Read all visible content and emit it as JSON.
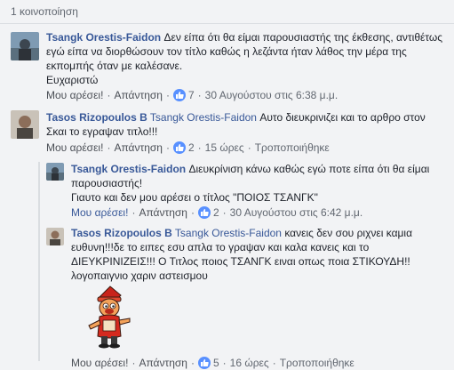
{
  "share_count": "1 κοινοποίηση",
  "comments": [
    {
      "author": "Tsangk Orestis-Faidon",
      "text": "Δεν είπα ότι θα είμαι παρουσιαστής της έκθεσης, αντιθέτως εγώ είπα να διορθώσουν τον τίτλο καθώς η λεζάντα ήταν λάθος την μέρα της εκπομπής όταν με καλέσανε.",
      "text2": "Ευχαριστώ",
      "like": "Μου αρέσει!",
      "reply": "Απάντηση",
      "reactions": "7",
      "time": "30 Αυγούστου στις 6:38 μ.μ."
    },
    {
      "author": "Tasos Rizopoulos B",
      "tag": "Tsangk Orestis-Faidon",
      "text": "Αυτο διευκρινιζει και το αρθρο στον Σκαι το εγραψαν τιτλο!!!",
      "like": "Μου αρέσει!",
      "reply": "Απάντηση",
      "reactions": "2",
      "time": "15 ώρες",
      "edited": "Τροποποιήθηκε"
    },
    {
      "author": "Tsangk Orestis-Faidon",
      "text": "Διευκρίνιση κάνω καθώς εγώ ποτε είπα ότι θα είμαι παρουσιαστής!",
      "text2": "Γιαυτο και δεν μου αρέσει ο τίτλος \"ΠΟΙΟΣ ΤΣΑΝΓΚ\"",
      "like": "Μου αρέσει!",
      "reply": "Απάντηση",
      "reactions": "2",
      "time": "30 Αυγούστου στις 6:42 μ.μ."
    },
    {
      "author": "Tasos Rizopoulos B",
      "tag": "Tsangk Orestis-Faidon",
      "text": "κανεις δεν σου ριχνει καμια ευθυνη!!!δε το ειπες εσυ απλα το γραψαν και καλα κανεις και το ΔΙΕΥΚΡΙΝΙΖΕΙΣ!!! Ο Τιτλος ποιος ΤΣΑΝΓΚ ειναι οπως ποια ΣΤΙΚΟΥΔΗ!! λογοπαιγνιο χαριν αστεισμου",
      "like": "Μου αρέσει!",
      "reply": "Απάντηση",
      "reactions": "5",
      "time": "16 ώρες",
      "edited": "Τροποποιήθηκε"
    }
  ],
  "colors": {
    "link": "#385898",
    "meta": "#616770",
    "reaction": "#5890ff"
  }
}
